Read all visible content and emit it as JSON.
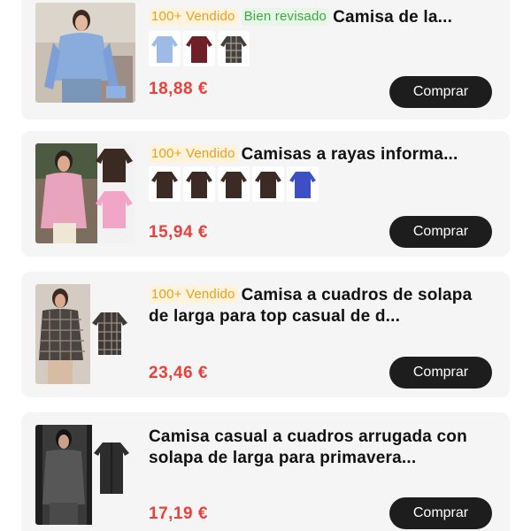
{
  "products": [
    {
      "badges": {
        "sold": "100+ Vendido",
        "review": "Bien revisado"
      },
      "title": "Camisa de la...",
      "variants": [
        "light-blue-shirt",
        "burgundy-sweater",
        "plaid-jacket"
      ],
      "price": "18,88 €",
      "buy_label": "Comprar"
    },
    {
      "badges": {
        "sold": "100+ Vendido"
      },
      "title": "Camisas a rayas informa...",
      "variants": [
        "brown-shirt",
        "brown-shirt",
        "brown-shirt",
        "brown-shirt",
        "blue-shirt"
      ],
      "price": "15,94 €",
      "buy_label": "Comprar"
    },
    {
      "badges": {
        "sold": "100+ Vendido"
      },
      "title": "Camisa a cuadros de solapa de larga para top casual de d...",
      "price": "23,46 €",
      "buy_label": "Comprar"
    },
    {
      "title": "Camisa casual a cuadros arrugada con solapa de larga para primavera...",
      "price": "17,19 €",
      "buy_label": "Comprar"
    }
  ],
  "colors": {
    "price": "#e8403a",
    "button_bg": "#1d1d1d",
    "sold_badge_text": "#e9a020",
    "review_badge_text": "#3aa944",
    "card_bg": "#f5f5f6"
  }
}
